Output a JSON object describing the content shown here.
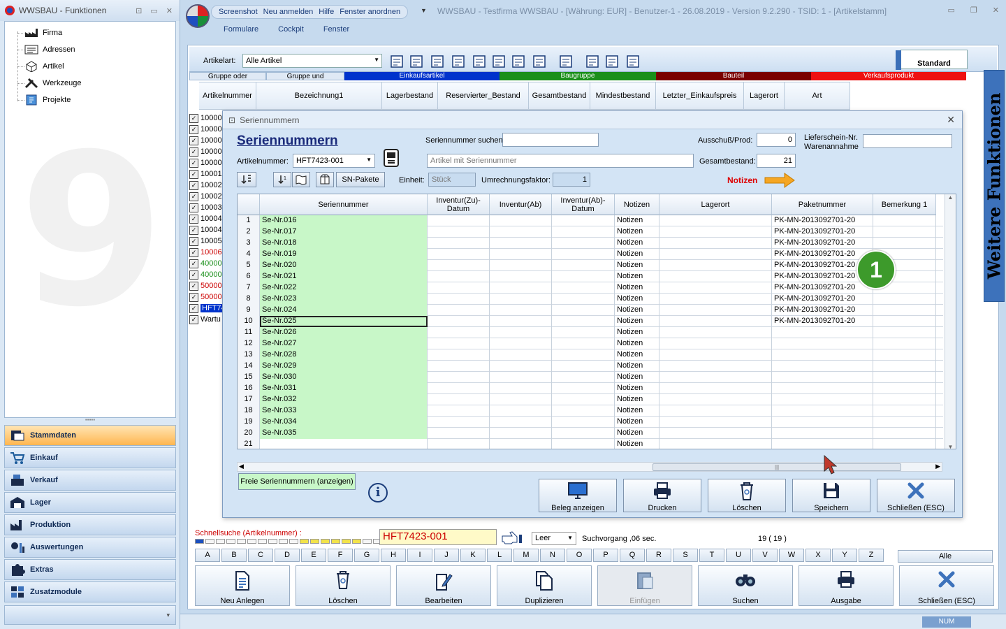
{
  "left_panel": {
    "title": "WWSBAU - Funktionen",
    "tree": [
      "Firma",
      "Adressen",
      "Artikel",
      "Werkzeuge",
      "Projekte"
    ],
    "nav": [
      {
        "label": "Stammdaten",
        "active": true,
        "icon": "database-icon"
      },
      {
        "label": "Einkauf",
        "active": false,
        "icon": "cart-icon"
      },
      {
        "label": "Verkauf",
        "active": false,
        "icon": "register-icon"
      },
      {
        "label": "Lager",
        "active": false,
        "icon": "warehouse-icon"
      },
      {
        "label": "Produktion",
        "active": false,
        "icon": "factory-icon"
      },
      {
        "label": "Auswertungen",
        "active": false,
        "icon": "chart-icon"
      },
      {
        "label": "Extras",
        "active": false,
        "icon": "puzzle-icon"
      },
      {
        "label": "Zusatzmodule",
        "active": false,
        "icon": "modules-icon"
      }
    ],
    "watermark": "9"
  },
  "main": {
    "title": "WWSBAU - Testfirma WWSBAU - [Währung: EUR] - Benutzer-1 - 26.08.2019 - Version 9.2.290 - TSID: 1  - [Artikelstamm]",
    "quick_access": [
      "Screenshot",
      "Neu anmelden",
      "Hilfe",
      "Fenster anordnen"
    ],
    "menu": [
      "Formulare",
      "Cockpit",
      "Fenster"
    ],
    "toolbar": {
      "artikelart_label": "Artikelart:",
      "artikelart_value": "Alle Artikel",
      "standard_label": "Standard"
    },
    "color_groups": [
      {
        "label": "Gruppe oder",
        "color": "#dfe9f5",
        "text": "#000"
      },
      {
        "label": "Gruppe und",
        "color": "#dfe9f5",
        "text": "#000"
      },
      {
        "label": "Einkaufsartikel",
        "color": "#0033cc",
        "text": "#fff"
      },
      {
        "label": "Baugruppe",
        "color": "#1a8f1a",
        "text": "#fff"
      },
      {
        "label": "Bauteil",
        "color": "#7a0000",
        "text": "#fff"
      },
      {
        "label": "Verkaufsprodukt",
        "color": "#ee1111",
        "text": "#fff"
      }
    ],
    "columns": [
      "Artikelnummer",
      "Bezeichnung1",
      "Lagerbestand",
      "Reservierter_Bestand",
      "Gesamtbestand",
      "Mindestbestand",
      "Letzter_Einkaufspreis",
      "Lagerort",
      "Art"
    ],
    "article_rows": [
      {
        "text": "10000",
        "color": "#000"
      },
      {
        "text": "10000",
        "color": "#000"
      },
      {
        "text": "10000",
        "color": "#000"
      },
      {
        "text": "10000",
        "color": "#000"
      },
      {
        "text": "10000",
        "color": "#000"
      },
      {
        "text": "10001",
        "color": "#000"
      },
      {
        "text": "10002",
        "color": "#000"
      },
      {
        "text": "10002",
        "color": "#000"
      },
      {
        "text": "10003",
        "color": "#000"
      },
      {
        "text": "10004",
        "color": "#000"
      },
      {
        "text": "10004",
        "color": "#000"
      },
      {
        "text": "10005",
        "color": "#000"
      },
      {
        "text": "10006",
        "color": "#cc0000"
      },
      {
        "text": "40000",
        "color": "#1a8f1a"
      },
      {
        "text": "40000",
        "color": "#1a8f1a"
      },
      {
        "text": "50000",
        "color": "#cc0000"
      },
      {
        "text": "50000",
        "color": "#cc0000"
      },
      {
        "text": "HFT74",
        "color": "#fff",
        "bg": "#0033cc"
      },
      {
        "text": "Wartu",
        "color": "#000"
      }
    ],
    "weitere": "Weitere Funktionen",
    "schnellsuche": {
      "label": "Schnellsuche (Artikelnummer) :",
      "value": "HFT7423-001",
      "leer": "Leer",
      "suchvorgang": "Suchvorgang ,06 sec.",
      "count": "19  ( 19 )"
    },
    "letters": [
      "A",
      "B",
      "C",
      "D",
      "E",
      "F",
      "G",
      "H",
      "I",
      "J",
      "K",
      "L",
      "M",
      "N",
      "O",
      "P",
      "Q",
      "R",
      "S",
      "T",
      "U",
      "V",
      "W",
      "X",
      "Y",
      "Z"
    ],
    "alle": "Alle",
    "buttons": [
      {
        "label": "Neu Anlegen",
        "icon": "new-document-icon",
        "disabled": false
      },
      {
        "label": "Löschen",
        "icon": "trash-icon",
        "disabled": false
      },
      {
        "label": "Bearbeiten",
        "icon": "edit-icon",
        "disabled": false
      },
      {
        "label": "Duplizieren",
        "icon": "duplicate-icon",
        "disabled": false
      },
      {
        "label": "Einfügen",
        "icon": "paste-icon",
        "disabled": true
      },
      {
        "label": "Suchen",
        "icon": "binoculars-icon",
        "disabled": false
      },
      {
        "label": "Ausgabe",
        "icon": "printer-icon",
        "disabled": false
      },
      {
        "label": "Schließen (ESC)",
        "icon": "close-icon",
        "disabled": false
      }
    ],
    "status_num": "NUM"
  },
  "dialog": {
    "title": "Seriennummern",
    "heading": "Seriennummern",
    "artikelnummer_label": "Artikelnummer:",
    "artikelnummer_value": "HFT7423-001",
    "suchen_label": "Seriennummer suchen:",
    "suchen_value": "",
    "artikel_placeholder": "Artikel mit Seriennummer",
    "ausschuss_label": "Ausschuß/Prod:",
    "ausschuss_value": "0",
    "gesamt_label": "Gesamtbestand:",
    "gesamt_value": "21",
    "liefer_label1": "Lieferschein-Nr.",
    "liefer_label2": "Warenannahme",
    "liefer_value": "",
    "einheit_label": "Einheit:",
    "einheit_value": "Stück",
    "umrechnung_label": "Umrechnungsfaktor:",
    "umrechnung_value": "1",
    "sn_pakete": "SN-Pakete",
    "notizen_label": "Notizen",
    "columns": [
      "Seriennummer",
      "Inventur(Zu)-Datum",
      "Inventur(Ab)",
      "Inventur(Ab)-Datum",
      "Notizen",
      "Lagerort",
      "Paketnummer",
      "Bemerkung 1"
    ],
    "note_label": "Notizen",
    "rows": [
      {
        "n": "1",
        "sn": "Se-Nr.016",
        "paket": "PK-MN-2013092701-20"
      },
      {
        "n": "2",
        "sn": "Se-Nr.017",
        "paket": "PK-MN-2013092701-20"
      },
      {
        "n": "3",
        "sn": "Se-Nr.018",
        "paket": "PK-MN-2013092701-20"
      },
      {
        "n": "4",
        "sn": "Se-Nr.019",
        "paket": "PK-MN-2013092701-20"
      },
      {
        "n": "5",
        "sn": "Se-Nr.020",
        "paket": "PK-MN-2013092701-20"
      },
      {
        "n": "6",
        "sn": "Se-Nr.021",
        "paket": "PK-MN-2013092701-20"
      },
      {
        "n": "7",
        "sn": "Se-Nr.022",
        "paket": "PK-MN-2013092701-20"
      },
      {
        "n": "8",
        "sn": "Se-Nr.023",
        "paket": "PK-MN-2013092701-20"
      },
      {
        "n": "9",
        "sn": "Se-Nr.024",
        "paket": "PK-MN-2013092701-20"
      },
      {
        "n": "10",
        "sn": "Se-Nr.025",
        "paket": "PK-MN-2013092701-20",
        "selected": true
      },
      {
        "n": "11",
        "sn": "Se-Nr.026",
        "paket": ""
      },
      {
        "n": "12",
        "sn": "Se-Nr.027",
        "paket": ""
      },
      {
        "n": "13",
        "sn": "Se-Nr.028",
        "paket": ""
      },
      {
        "n": "14",
        "sn": "Se-Nr.029",
        "paket": ""
      },
      {
        "n": "15",
        "sn": "Se-Nr.030",
        "paket": ""
      },
      {
        "n": "16",
        "sn": "Se-Nr.031",
        "paket": ""
      },
      {
        "n": "17",
        "sn": "Se-Nr.032",
        "paket": ""
      },
      {
        "n": "18",
        "sn": "Se-Nr.033",
        "paket": ""
      },
      {
        "n": "19",
        "sn": "Se-Nr.034",
        "paket": ""
      },
      {
        "n": "20",
        "sn": "Se-Nr.035",
        "paket": ""
      },
      {
        "n": "21",
        "sn": "",
        "paket": ""
      }
    ],
    "freie_btn": "Freie Seriennummern (anzeigen)",
    "buttons": [
      {
        "label": "Beleg anzeigen",
        "icon": "monitor-icon"
      },
      {
        "label": "Drucken",
        "icon": "printer-icon"
      },
      {
        "label": "Löschen",
        "icon": "trash-icon"
      },
      {
        "label": "Speichern",
        "icon": "save-icon"
      },
      {
        "label": "Schließen (ESC)",
        "icon": "close-icon"
      }
    ]
  },
  "badge": "1"
}
